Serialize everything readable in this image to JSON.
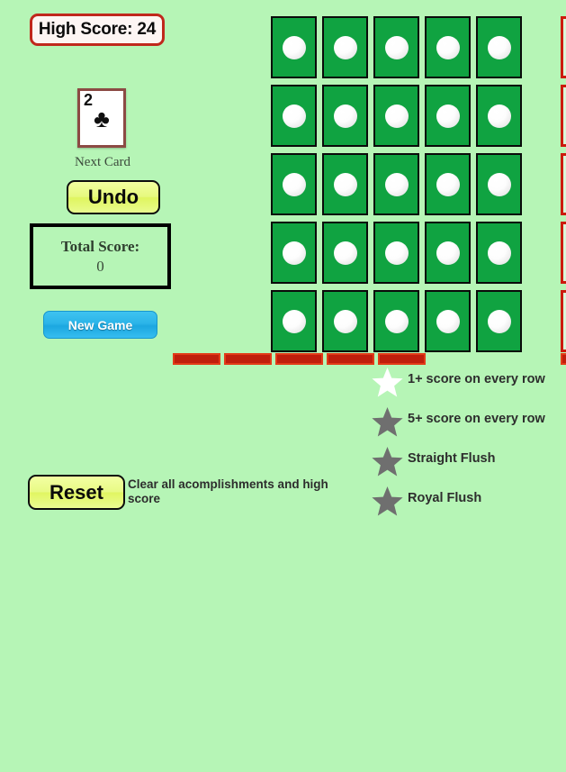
{
  "app": {
    "background_color": "#b6f5b6",
    "title": "Solitaire Poker Squares"
  },
  "high_score": {
    "label": "High Score: 24",
    "value": 24,
    "border_color": "#c0281c"
  },
  "next_card": {
    "rank": "2",
    "suit_symbol": "♣",
    "suit_name": "clubs",
    "caption": "Next Card",
    "border_color": "#8c4a44"
  },
  "buttons": {
    "undo": "Undo",
    "new_game": "New Game",
    "reset": "Reset",
    "reset_description": "Clear all acomplishments and high score",
    "new_game_color": "#2bb4e8",
    "undo_color": "#e6f97e"
  },
  "total_score": {
    "label": "Total Score:",
    "value": "0"
  },
  "grid": {
    "rows": 5,
    "cols": 5,
    "cell_color": "#10a341",
    "chip_color": "#ffffff",
    "cells": [
      [
        "empty",
        "empty",
        "empty",
        "empty",
        "empty"
      ],
      [
        "empty",
        "empty",
        "empty",
        "empty",
        "empty"
      ],
      [
        "empty",
        "empty",
        "empty",
        "empty",
        "empty"
      ],
      [
        "empty",
        "empty",
        "empty",
        "empty",
        "empty"
      ],
      [
        "empty",
        "empty",
        "empty",
        "empty",
        "empty"
      ]
    ]
  },
  "markers": {
    "marker_color": "#cc1a0d",
    "row_scores": [
      "",
      "",
      "",
      "",
      ""
    ],
    "col_scores": [
      "",
      "",
      "",
      "",
      ""
    ],
    "diagonal_score": ""
  },
  "achievements": [
    {
      "label": "1+ score on every row",
      "earned": true,
      "star_color": "#ffffff"
    },
    {
      "label": "5+ score on every row",
      "earned": false,
      "star_color": "#6f6f6f"
    },
    {
      "label": "Straight Flush",
      "earned": false,
      "star_color": "#6f6f6f"
    },
    {
      "label": "Royal Flush",
      "earned": false,
      "star_color": "#6f6f6f"
    }
  ]
}
